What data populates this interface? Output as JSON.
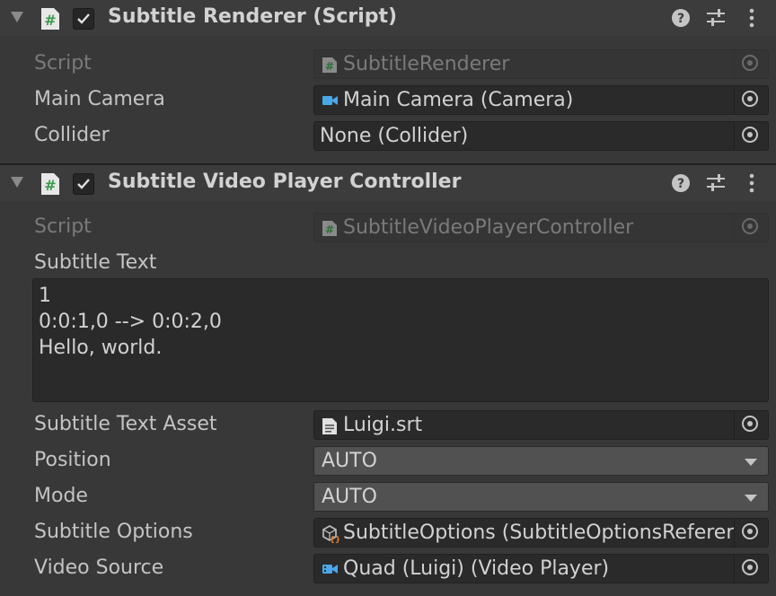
{
  "components": [
    {
      "title": "Subtitle Renderer (Script)",
      "enabled": true,
      "fields": {
        "script": {
          "label": "Script",
          "value": "SubtitleRenderer"
        },
        "main_camera": {
          "label": "Main Camera",
          "value": "Main Camera (Camera)"
        },
        "collider": {
          "label": "Collider",
          "value": "None (Collider)"
        }
      }
    },
    {
      "title": "Subtitle Video Player Controller",
      "enabled": true,
      "fields": {
        "script": {
          "label": "Script",
          "value": "SubtitleVideoPlayerController"
        },
        "subtitle_text": {
          "label": "Subtitle Text",
          "lines": [
            "1",
            "0:0:1,0 --> 0:0:2,0",
            "Hello, world."
          ]
        },
        "subtitle_text_asset": {
          "label": "Subtitle Text Asset",
          "value": "Luigi.srt"
        },
        "position": {
          "label": "Position",
          "value": "AUTO"
        },
        "mode": {
          "label": "Mode",
          "value": "AUTO"
        },
        "subtitle_options": {
          "label": "Subtitle Options",
          "value": "SubtitleOptions (SubtitleOptionsReferer"
        },
        "video_source": {
          "label": "Video Source",
          "value": "Quad (Luigi) (Video Player)"
        }
      }
    }
  ],
  "icons": {
    "header_icons": [
      "script-icon",
      "checkbox-check-icon",
      "help-icon",
      "presets-icon",
      "more-options-icon"
    ],
    "field_icons": [
      "script-icon",
      "camera-icon",
      "text-asset-icon",
      "scriptable-object-icon",
      "video-player-icon",
      "object-picker-icon"
    ]
  },
  "colors": {
    "background": "#383838",
    "header_background": "#3c3c3c",
    "field_background": "#2a2a2a",
    "dropdown_background": "#515151",
    "script_icon_green": "#3a9a4a",
    "camera_icon_blue": "#4aa8e8",
    "scriptable_icon_orange": "#e07a2a"
  }
}
